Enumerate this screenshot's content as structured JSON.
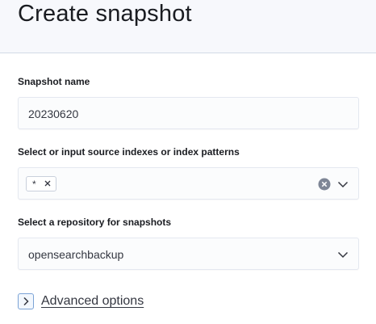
{
  "page": {
    "title": "Create snapshot"
  },
  "form": {
    "snapshot_name": {
      "label": "Snapshot name",
      "value": "20230620"
    },
    "indexes": {
      "label": "Select or input source indexes or index patterns",
      "selected": [
        "*"
      ],
      "clear_icon": "clear-circle-icon",
      "dropdown_icon": "chevron-down-icon"
    },
    "repository": {
      "label": "Select a repository for snapshots",
      "value": "opensearchbackup",
      "dropdown_icon": "chevron-down-icon"
    },
    "advanced": {
      "label": "Advanced options",
      "icon": "chevron-right-icon"
    }
  },
  "colors": {
    "header_bg": "#f7f8fc",
    "field_bg": "#fbfcfd",
    "accent": "#7ba3d6",
    "text": "#343741"
  }
}
